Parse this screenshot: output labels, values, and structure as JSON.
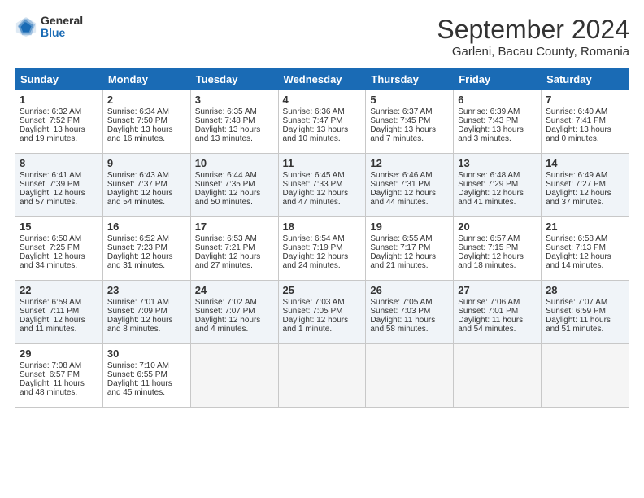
{
  "header": {
    "logo_general": "General",
    "logo_blue": "Blue",
    "month_title": "September 2024",
    "location": "Garleni, Bacau County, Romania"
  },
  "days_of_week": [
    "Sunday",
    "Monday",
    "Tuesday",
    "Wednesday",
    "Thursday",
    "Friday",
    "Saturday"
  ],
  "weeks": [
    [
      {
        "day": "1",
        "sunrise": "6:32 AM",
        "sunset": "7:52 PM",
        "daylight": "13 hours and 19 minutes."
      },
      {
        "day": "2",
        "sunrise": "6:34 AM",
        "sunset": "7:50 PM",
        "daylight": "13 hours and 16 minutes."
      },
      {
        "day": "3",
        "sunrise": "6:35 AM",
        "sunset": "7:48 PM",
        "daylight": "13 hours and 13 minutes."
      },
      {
        "day": "4",
        "sunrise": "6:36 AM",
        "sunset": "7:47 PM",
        "daylight": "13 hours and 10 minutes."
      },
      {
        "day": "5",
        "sunrise": "6:37 AM",
        "sunset": "7:45 PM",
        "daylight": "13 hours and 7 minutes."
      },
      {
        "day": "6",
        "sunrise": "6:39 AM",
        "sunset": "7:43 PM",
        "daylight": "13 hours and 3 minutes."
      },
      {
        "day": "7",
        "sunrise": "6:40 AM",
        "sunset": "7:41 PM",
        "daylight": "13 hours and 0 minutes."
      }
    ],
    [
      {
        "day": "8",
        "sunrise": "6:41 AM",
        "sunset": "7:39 PM",
        "daylight": "12 hours and 57 minutes."
      },
      {
        "day": "9",
        "sunrise": "6:43 AM",
        "sunset": "7:37 PM",
        "daylight": "12 hours and 54 minutes."
      },
      {
        "day": "10",
        "sunrise": "6:44 AM",
        "sunset": "7:35 PM",
        "daylight": "12 hours and 50 minutes."
      },
      {
        "day": "11",
        "sunrise": "6:45 AM",
        "sunset": "7:33 PM",
        "daylight": "12 hours and 47 minutes."
      },
      {
        "day": "12",
        "sunrise": "6:46 AM",
        "sunset": "7:31 PM",
        "daylight": "12 hours and 44 minutes."
      },
      {
        "day": "13",
        "sunrise": "6:48 AM",
        "sunset": "7:29 PM",
        "daylight": "12 hours and 41 minutes."
      },
      {
        "day": "14",
        "sunrise": "6:49 AM",
        "sunset": "7:27 PM",
        "daylight": "12 hours and 37 minutes."
      }
    ],
    [
      {
        "day": "15",
        "sunrise": "6:50 AM",
        "sunset": "7:25 PM",
        "daylight": "12 hours and 34 minutes."
      },
      {
        "day": "16",
        "sunrise": "6:52 AM",
        "sunset": "7:23 PM",
        "daylight": "12 hours and 31 minutes."
      },
      {
        "day": "17",
        "sunrise": "6:53 AM",
        "sunset": "7:21 PM",
        "daylight": "12 hours and 27 minutes."
      },
      {
        "day": "18",
        "sunrise": "6:54 AM",
        "sunset": "7:19 PM",
        "daylight": "12 hours and 24 minutes."
      },
      {
        "day": "19",
        "sunrise": "6:55 AM",
        "sunset": "7:17 PM",
        "daylight": "12 hours and 21 minutes."
      },
      {
        "day": "20",
        "sunrise": "6:57 AM",
        "sunset": "7:15 PM",
        "daylight": "12 hours and 18 minutes."
      },
      {
        "day": "21",
        "sunrise": "6:58 AM",
        "sunset": "7:13 PM",
        "daylight": "12 hours and 14 minutes."
      }
    ],
    [
      {
        "day": "22",
        "sunrise": "6:59 AM",
        "sunset": "7:11 PM",
        "daylight": "12 hours and 11 minutes."
      },
      {
        "day": "23",
        "sunrise": "7:01 AM",
        "sunset": "7:09 PM",
        "daylight": "12 hours and 8 minutes."
      },
      {
        "day": "24",
        "sunrise": "7:02 AM",
        "sunset": "7:07 PM",
        "daylight": "12 hours and 4 minutes."
      },
      {
        "day": "25",
        "sunrise": "7:03 AM",
        "sunset": "7:05 PM",
        "daylight": "12 hours and 1 minute."
      },
      {
        "day": "26",
        "sunrise": "7:05 AM",
        "sunset": "7:03 PM",
        "daylight": "11 hours and 58 minutes."
      },
      {
        "day": "27",
        "sunrise": "7:06 AM",
        "sunset": "7:01 PM",
        "daylight": "11 hours and 54 minutes."
      },
      {
        "day": "28",
        "sunrise": "7:07 AM",
        "sunset": "6:59 PM",
        "daylight": "11 hours and 51 minutes."
      }
    ],
    [
      {
        "day": "29",
        "sunrise": "7:08 AM",
        "sunset": "6:57 PM",
        "daylight": "11 hours and 48 minutes."
      },
      {
        "day": "30",
        "sunrise": "7:10 AM",
        "sunset": "6:55 PM",
        "daylight": "11 hours and 45 minutes."
      },
      null,
      null,
      null,
      null,
      null
    ]
  ]
}
